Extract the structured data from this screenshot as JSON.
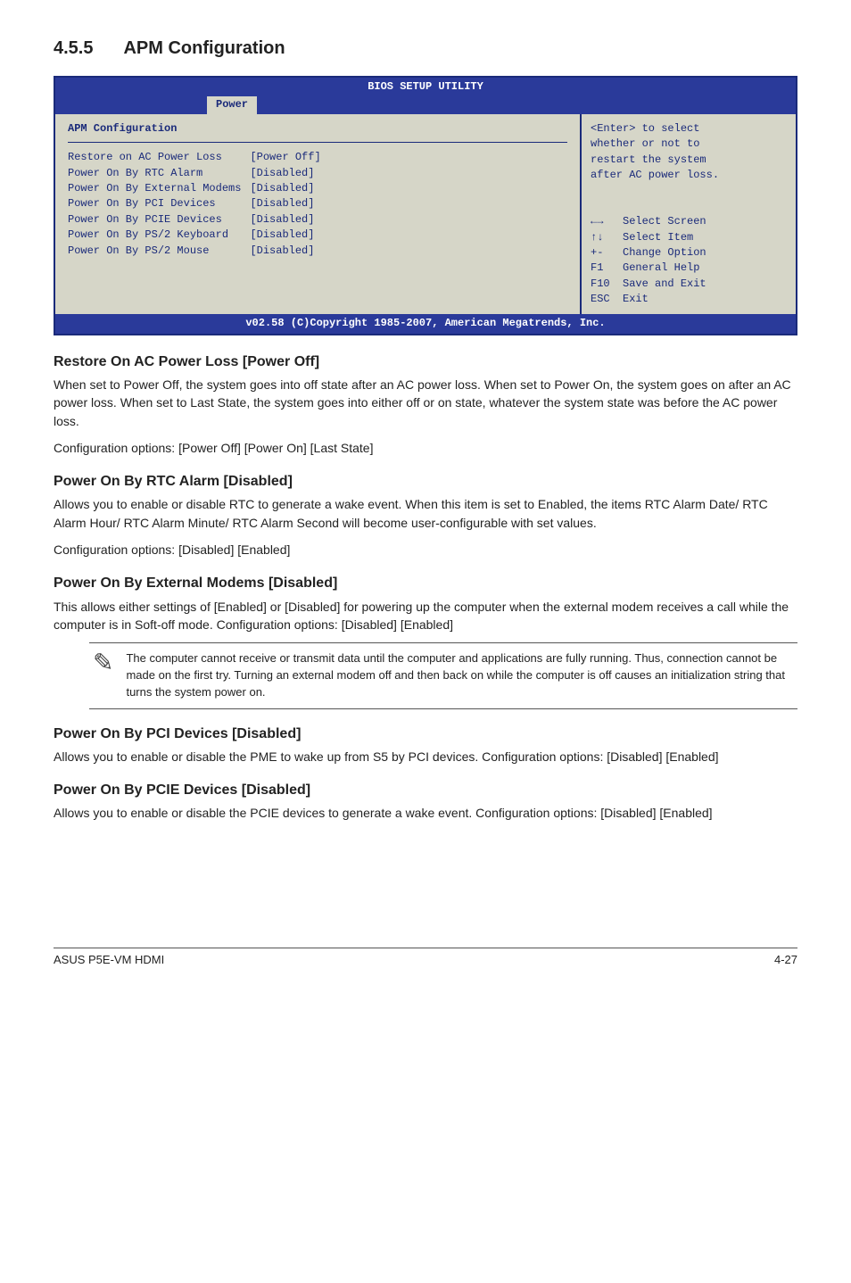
{
  "section_number": "4.5.5",
  "section_title": "APM Configuration",
  "bios": {
    "title": "BIOS SETUP UTILITY",
    "tab": "Power",
    "panel_header": "APM Configuration",
    "rows": [
      {
        "label": "Restore on AC Power Loss",
        "value": "[Power Off]"
      },
      {
        "label": "Power On By RTC Alarm",
        "value": "[Disabled]"
      },
      {
        "label": "Power On By External Modems",
        "value": "[Disabled]"
      },
      {
        "label": "Power On By PCI Devices",
        "value": "[Disabled]"
      },
      {
        "label": "Power On By PCIE Devices",
        "value": "[Disabled]"
      },
      {
        "label": "Power On By PS/2 Keyboard",
        "value": "[Disabled]"
      },
      {
        "label": "Power On By PS/2 Mouse",
        "value": "[Disabled]"
      }
    ],
    "help_text": "<Enter> to select\nwhether or not to\nrestart the system\nafter AC power loss.",
    "nav": "←→   Select Screen\n↑↓   Select Item\n+-   Change Option\nF1   General Help\nF10  Save and Exit\nESC  Exit",
    "footer": "v02.58 (C)Copyright 1985-2007, American Megatrends, Inc."
  },
  "sections": {
    "restore": {
      "h": "Restore On AC Power Loss [Power Off]",
      "p1": "When set to Power Off, the system goes into off state after an AC power loss. When set to Power On, the system goes on after an AC power loss. When set to Last State, the system goes into either off or on state, whatever the system state was before the AC power loss.",
      "p2": "Configuration options: [Power Off] [Power On] [Last State]"
    },
    "rtc": {
      "h": "Power On By RTC Alarm [Disabled]",
      "p1": "Allows you to enable or disable RTC to generate a wake event. When this item is set to Enabled, the items RTC Alarm Date/ RTC Alarm Hour/ RTC Alarm Minute/ RTC Alarm Second will become user-configurable with set values.",
      "p2": "Configuration options: [Disabled] [Enabled]"
    },
    "ext": {
      "h": "Power On By External Modems [Disabled]",
      "p1": "This allows either settings of [Enabled] or [Disabled] for powering up the computer when the external modem receives a call while the computer is in Soft-off mode. Configuration options: [Disabled] [Enabled]"
    },
    "note": "The computer cannot receive or transmit data until the computer and applications are fully running. Thus, connection cannot be made on the first try. Turning an external modem off and then back on while the computer is off causes an initialization string that turns the system power on.",
    "pci": {
      "h": "Power On By PCI Devices [Disabled]",
      "p1": "Allows you to enable or disable the PME to wake up from S5 by PCI devices. Configuration options: [Disabled] [Enabled]"
    },
    "pcie": {
      "h": "Power On By PCIE Devices [Disabled]",
      "p1": "Allows you to enable or disable the PCIE devices to generate a wake event. Configuration options: [Disabled] [Enabled]"
    }
  },
  "footer": {
    "left": "ASUS P5E-VM HDMI",
    "right": "4-27"
  }
}
